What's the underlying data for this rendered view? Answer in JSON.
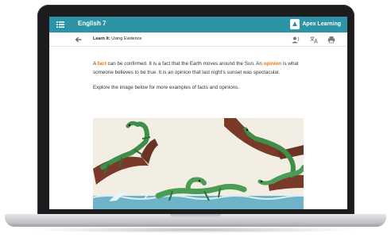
{
  "header": {
    "course_title": "English 7",
    "brand_name": "Apex Learning"
  },
  "subheader": {
    "section_label": "Learn It:",
    "section_title": "Using Evidence"
  },
  "icons": {
    "menu": "menu-list-icon",
    "back": "arrow-left-icon",
    "read_aloud": "read-aloud-icon",
    "translate": "translate-icon",
    "print": "printer-icon"
  },
  "colors": {
    "header_bg": "#2d93a6",
    "term_highlight": "#e27a17"
  },
  "lesson": {
    "p1_a": "A ",
    "p1_fact": "fact",
    "p1_b": " can be confirmed. It is a fact that the Earth moves around the Sun. An ",
    "p1_opinion": "opinion",
    "p1_c": " is what someone believes to be true. It is an opinion that last night's sunset was spectacular.",
    "p2": "Explore the image below for more examples of facts and opinions."
  }
}
